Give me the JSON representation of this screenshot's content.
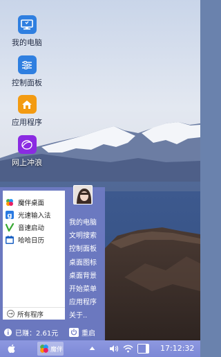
{
  "desktop": {
    "icons": [
      {
        "label": "我的电脑",
        "icon": "monitor-icon"
      },
      {
        "label": "控制面板",
        "icon": "sliders-icon"
      },
      {
        "label": "应用程序",
        "icon": "house-icon"
      },
      {
        "label": "网上冲浪",
        "icon": "globe-icon"
      }
    ]
  },
  "start_menu": {
    "apps": [
      {
        "label": "魔伴桌面",
        "icon": "pinwheel-icon"
      },
      {
        "label": "光速输入法",
        "icon": "g-keyboard-icon"
      },
      {
        "label": "音速启动",
        "icon": "v-check-icon"
      },
      {
        "label": "哈哈日历",
        "icon": "calendar-icon"
      }
    ],
    "all_programs": "所有程序",
    "right_items": [
      "我的电脑",
      "文明搜索",
      "控制面板",
      "桌面图标",
      "桌面背景",
      "开始菜单",
      "应用程序",
      "关于.."
    ],
    "earned": "已赚：2.61元",
    "restart": "重启"
  },
  "taskbar": {
    "app_label": "魔伴",
    "clock": "17:12:32",
    "battery_level": 0.3
  },
  "colors": {
    "menu_bg": "#707cc4",
    "taskbar": "#7c88d6"
  }
}
